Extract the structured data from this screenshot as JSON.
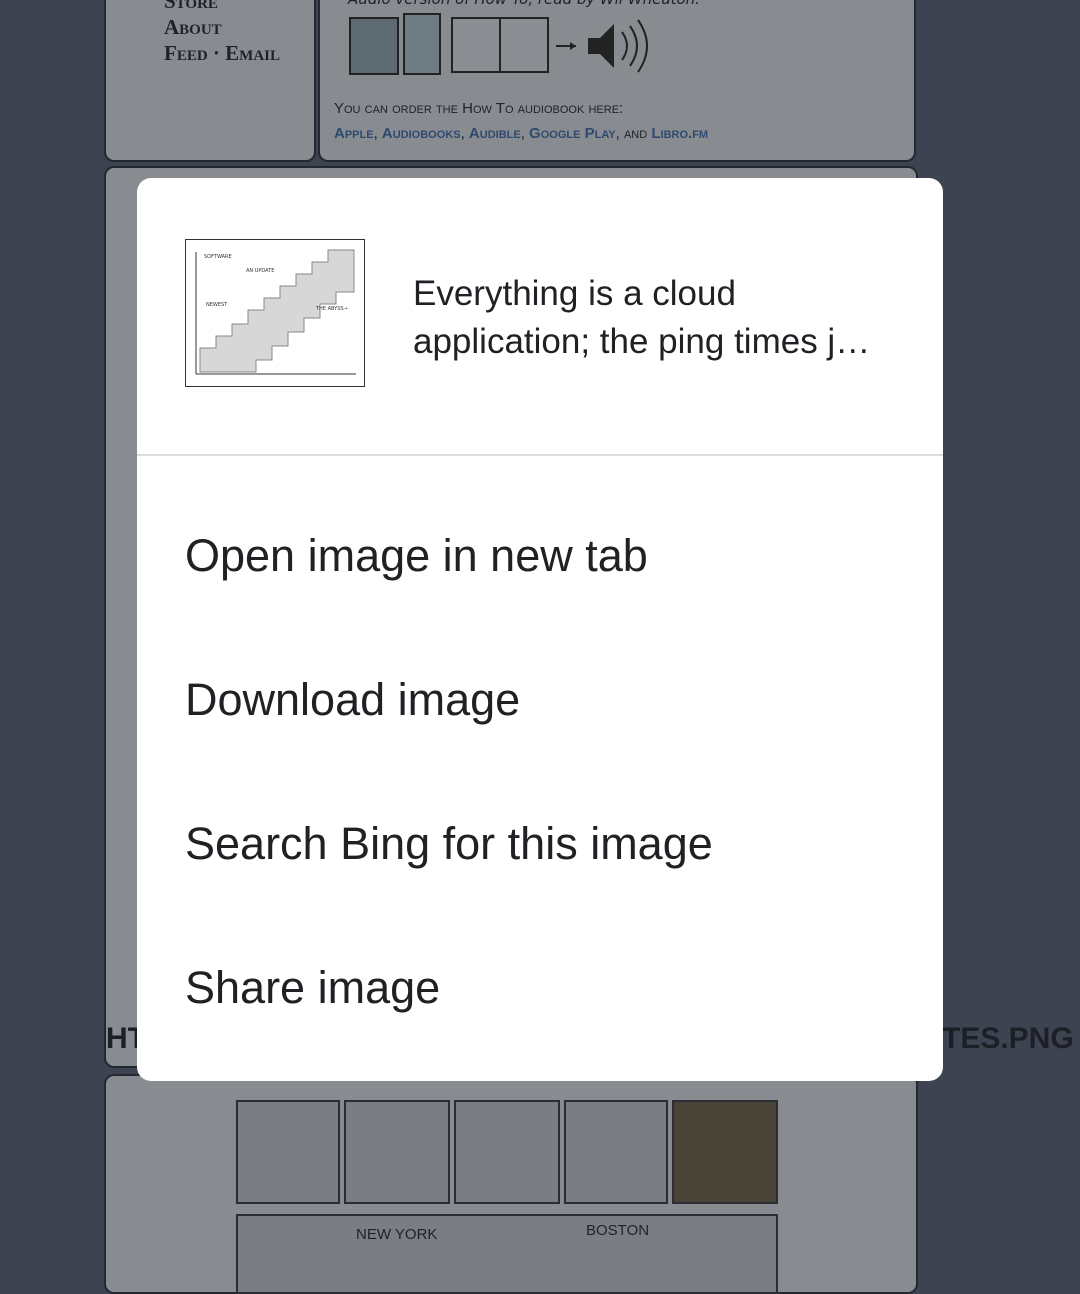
{
  "background": {
    "nav_links": [
      "Store",
      "About",
      "Feed · Email"
    ],
    "audio_heading": "Audio version of How To, read by Wil Wheaton.",
    "order_text": "You can order the How To audiobook here:",
    "order_links": [
      "Apple",
      "Audiobooks",
      "Audible",
      "Google Play",
      "Libro.fm"
    ],
    "order_and": "and",
    "side_text_left": "HT",
    "side_text_right": "TES.PNG",
    "strip_label_1": "NEW YORK",
    "strip_label_2": "BOSTON"
  },
  "dialog": {
    "caption_line1": "Everything is a cloud",
    "caption_line2": "application; the ping times j…",
    "menu": [
      {
        "label": "Open image in new tab"
      },
      {
        "label": "Download image"
      },
      {
        "label": "Search Bing for this image"
      },
      {
        "label": "Share image"
      }
    ]
  },
  "colors": {
    "scrim": "#3d4350",
    "dialog_bg": "#ffffff",
    "text": "#202124"
  }
}
